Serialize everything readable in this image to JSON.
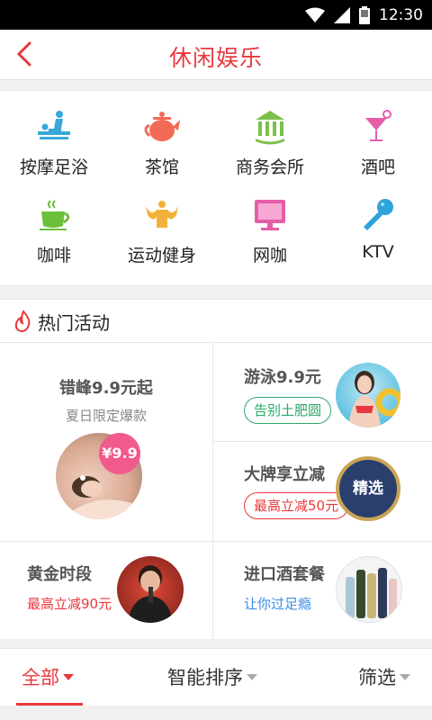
{
  "status": {
    "time": "12:30"
  },
  "header": {
    "title": "休闲娱乐"
  },
  "categories": [
    {
      "label": "按摩足浴",
      "icon": "massage-icon",
      "color": "#3aa7d9"
    },
    {
      "label": "茶馆",
      "icon": "teapot-icon",
      "color": "#f26a55"
    },
    {
      "label": "商务会所",
      "icon": "building-icon",
      "color": "#7cc04a"
    },
    {
      "label": "酒吧",
      "icon": "cocktail-icon",
      "color": "#e55ea9"
    },
    {
      "label": "咖啡",
      "icon": "coffee-icon",
      "color": "#6cbf3c"
    },
    {
      "label": "运动健身",
      "icon": "fitness-icon",
      "color": "#f2b23a"
    },
    {
      "label": "网咖",
      "icon": "monitor-icon",
      "color": "#e55ea9"
    },
    {
      "label": "KTV",
      "icon": "microphone-icon",
      "color": "#2fa3dc"
    }
  ],
  "hot": {
    "title": "热门活动",
    "main": {
      "title": "错峰9.9元起",
      "subtitle": "夏日限定爆款",
      "badge": "¥9.9"
    },
    "swim": {
      "title": "游泳9.9元",
      "tag": "告别土肥圆"
    },
    "brand": {
      "title": "大牌享立减",
      "tag": "最高立减50元",
      "badge": "精选"
    },
    "golden": {
      "title": "黄金时段",
      "tag": "最高立减90元"
    },
    "wine": {
      "title": "进口酒套餐",
      "tag": "让你过足瘾"
    }
  },
  "colors": {
    "accent": "#e8383d",
    "green": "#2aa86a",
    "blue": "#3a8ee6"
  },
  "filters": [
    {
      "label": "全部",
      "active": true
    },
    {
      "label": "智能排序",
      "active": false
    },
    {
      "label": "筛选",
      "active": false
    }
  ]
}
